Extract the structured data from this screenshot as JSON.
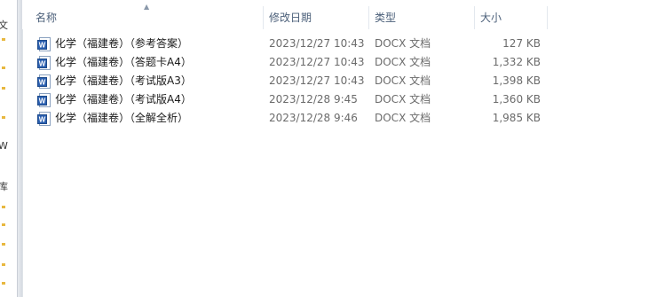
{
  "nav": {
    "glyphs": [
      "文",
      "W",
      "库"
    ]
  },
  "columns": {
    "name": "名称",
    "modified": "修改日期",
    "type": "类型",
    "size": "大小"
  },
  "files": [
    {
      "name": "化学（福建卷）（参考答案）",
      "modified": "2023/12/27 10:43",
      "type": "DOCX 文档",
      "size": "127 KB",
      "icon": "word-doc-icon"
    },
    {
      "name": "化学（福建卷）（答题卡A4）",
      "modified": "2023/12/27 10:43",
      "type": "DOCX 文档",
      "size": "1,332 KB",
      "icon": "word-doc-icon"
    },
    {
      "name": "化学（福建卷）（考试版A3）",
      "modified": "2023/12/27 10:43",
      "type": "DOCX 文档",
      "size": "1,398 KB",
      "icon": "word-doc-icon"
    },
    {
      "name": "化学（福建卷）（考试版A4）",
      "modified": "2023/12/28 9:45",
      "type": "DOCX 文档",
      "size": "1,360 KB",
      "icon": "word-doc-icon"
    },
    {
      "name": "化学（福建卷）（全解全析）",
      "modified": "2023/12/28 9:46",
      "type": "DOCX 文档",
      "size": "1,985 KB",
      "icon": "word-doc-icon"
    }
  ],
  "colors": {
    "header_text": "#4c607a",
    "icon_blue": "#2a5fb0"
  }
}
